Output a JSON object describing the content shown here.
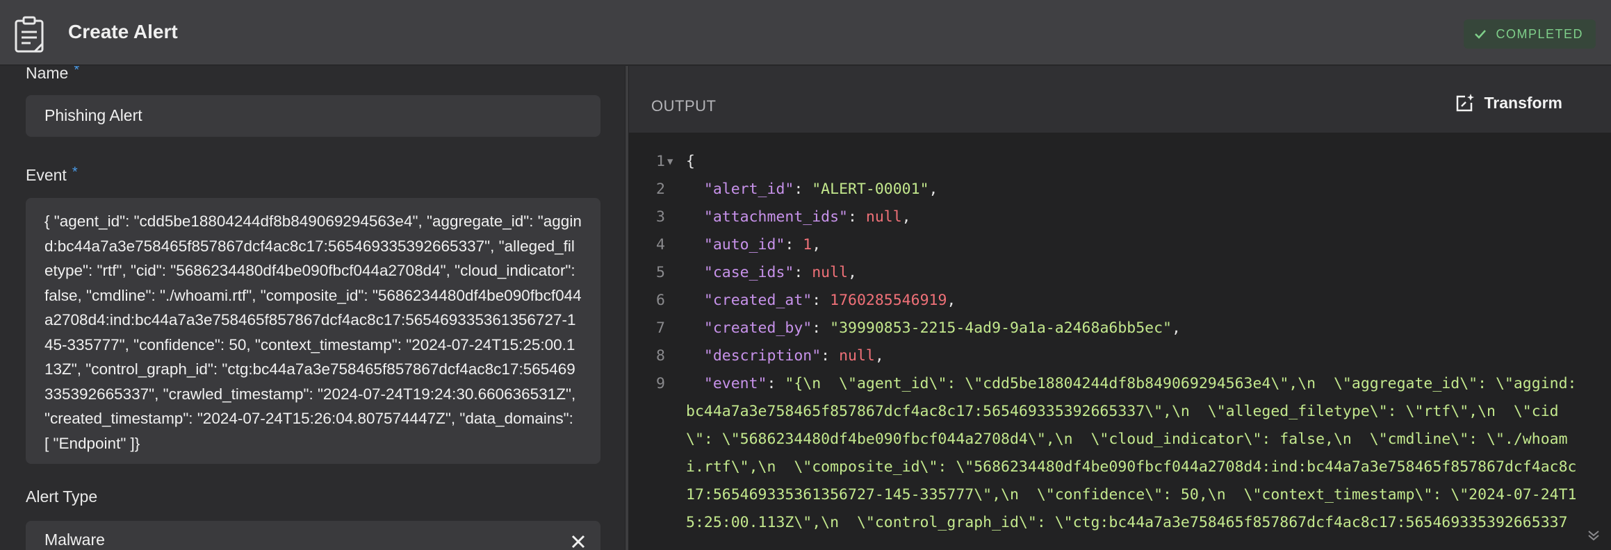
{
  "header": {
    "title": "Create Alert",
    "status": "COMPLETED",
    "colors": {
      "header_bg": "#404043",
      "status_text": "#7fcf8a"
    },
    "icons": {
      "title_icon": "clipboard-icon",
      "status_icon": "check-icon"
    }
  },
  "form": {
    "name": {
      "label": "Name",
      "required_mark": "*",
      "value": "Phishing Alert"
    },
    "event": {
      "label": "Event",
      "required_mark": "*",
      "value": "{ \"agent_id\": \"cdd5be18804244df8b849069294563e4\",  \"aggregate_id\": \"aggind:bc44a7a3e758465f857867dcf4ac8c17:565469335392665337\",  \"alleged_filetype\": \"rtf\",  \"cid\": \"5686234480df4be090fbcf044a2708d4\",  \"cloud_indicator\": false,  \"cmdline\": \"./whoami.rtf\",  \"composite_id\": \"5686234480df4be090fbcf044a2708d4:ind:bc44a7a3e758465f857867dcf4ac8c17:565469335361356727-145-335777\",  \"confidence\": 50,  \"context_timestamp\": \"2024-07-24T15:25:00.113Z\",  \"control_graph_id\": \"ctg:bc44a7a3e758465f857867dcf4ac8c17:565469335392665337\",  \"crawled_timestamp\": \"2024-07-24T19:24:30.660636531Z\",  \"created_timestamp\": \"2024-07-24T15:26:04.807574447Z\",  \"data_domains\": [    \"Endpoint\"  ]}"
    },
    "alert_type": {
      "label": "Alert Type",
      "value": "Malware",
      "clear_icon": "close-icon"
    }
  },
  "output": {
    "title": "OUTPUT",
    "transform_label": "Transform",
    "transform_icon": "transform-icon",
    "lines": [
      {
        "num": "1",
        "text": "{"
      },
      {
        "num": "2",
        "key": "\"alert_id\"",
        "value": "\"ALERT-00001\"",
        "vtype": "s"
      },
      {
        "num": "3",
        "key": "\"attachment_ids\"",
        "value": "null",
        "vtype": "n"
      },
      {
        "num": "4",
        "key": "\"auto_id\"",
        "value": "1",
        "vtype": "n"
      },
      {
        "num": "5",
        "key": "\"case_ids\"",
        "value": "null",
        "vtype": "n"
      },
      {
        "num": "6",
        "key": "\"created_at\"",
        "value": "1760285546919",
        "vtype": "n"
      },
      {
        "num": "7",
        "key": "\"created_by\"",
        "value": "\"39990853-2215-4ad9-9a1a-a2468a6bb5ec\"",
        "vtype": "s"
      },
      {
        "num": "8",
        "key": "\"description\"",
        "value": "null",
        "vtype": "n"
      },
      {
        "num": "9",
        "key": "\"event\""
      }
    ],
    "event_line_key": "\"event\"",
    "event_value_rows": [
      "\"{\\n  \\\"agent_id\\\": \\\"cdd5be18804244df8b849069294563e4\\\",\\n  \\\"aggregate_id\\\": \\\"aggind:",
      "bc44a7a3e758465f857867dcf4ac8c17:565469335392665337\\\",\\n  \\\"alleged_filetype\\\": \\\"rtf\\\",\\n  \\\"cid",
      "\\\": \\\"5686234480df4be090fbcf044a2708d4\\\",\\n  \\\"cloud_indicator\\\": false,\\n  \\\"cmdline\\\": \\\"./whoam",
      "i.rtf\\\",\\n  \\\"composite_id\\\": \\\"5686234480df4be090fbcf044a2708d4:ind:bc44a7a3e758465f857867dcf4ac8c",
      "17:565469335361356727-145-335777\\\",\\n  \\\"confidence\\\": 50,\\n  \\\"context_timestamp\\\": \\\"2024-07-24T1",
      "5:25:00.113Z\\\",\\n  \\\"control_graph_id\\\": \\\"ctg:bc44a7a3e758465f857867dcf4ac8c17:565469335392665337"
    ],
    "colors": {
      "key": "#c792ea",
      "string": "#c3e88d",
      "number": "#f07178"
    }
  }
}
